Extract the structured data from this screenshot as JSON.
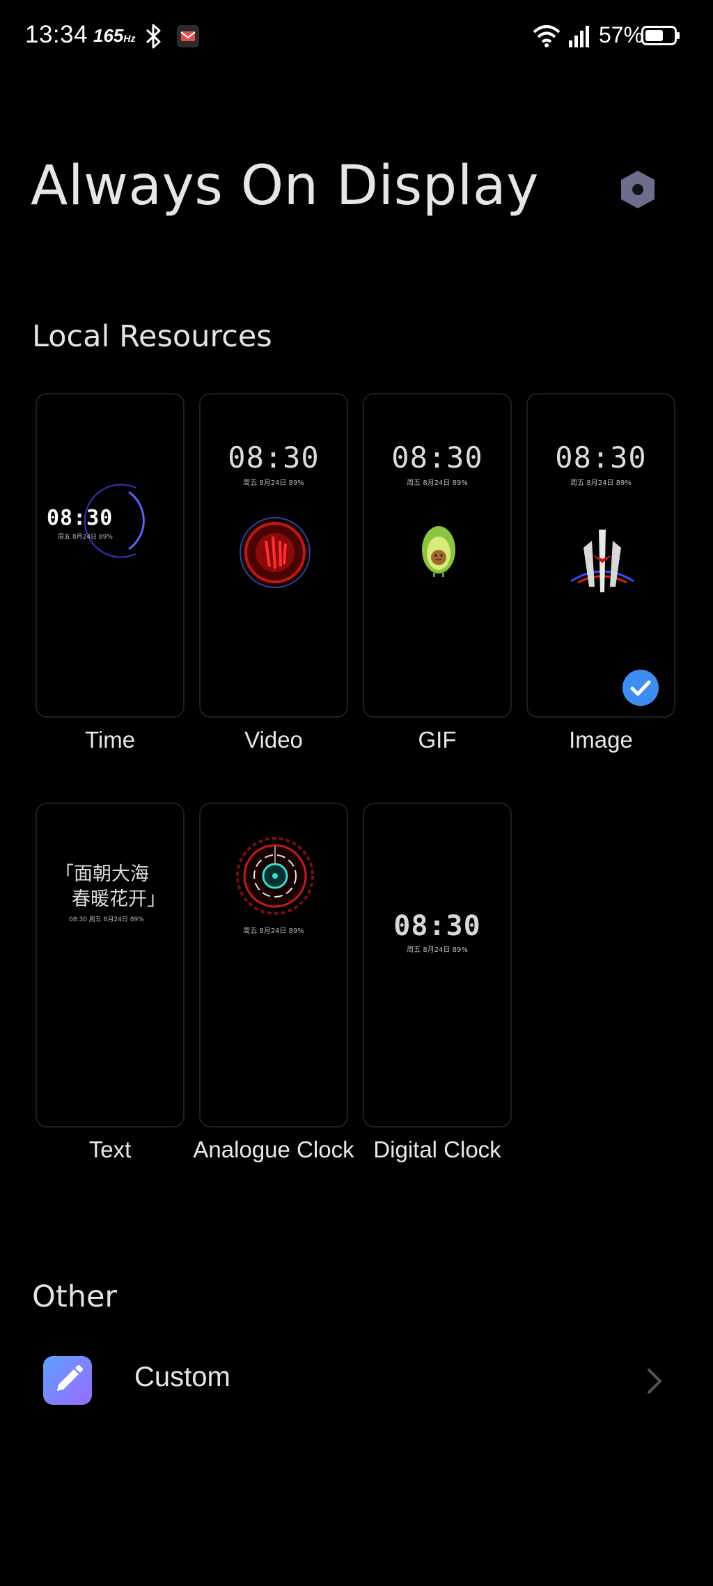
{
  "status_bar": {
    "time": "13:34",
    "refresh_rate": "165",
    "refresh_unit": "Hz",
    "battery_percent": "57%",
    "icons": [
      "bluetooth-icon",
      "mail-icon",
      "wifi-icon",
      "signal-icon",
      "battery-icon"
    ]
  },
  "header": {
    "title": "Always On Display",
    "settings_icon": "hexagon-settings-icon"
  },
  "local_resources": {
    "title": "Local Resources",
    "items": [
      {
        "label": "Time",
        "preview": {
          "clock": "08:30",
          "sub": "周五 8月24日 89%"
        },
        "selected": false
      },
      {
        "label": "Video",
        "preview": {
          "clock": "08:30",
          "sub": "周五 8月24日 89%"
        },
        "selected": false
      },
      {
        "label": "GIF",
        "preview": {
          "clock": "08:30",
          "sub": "周五 8月24日 89%"
        },
        "selected": false
      },
      {
        "label": "Image",
        "preview": {
          "clock": "08:30",
          "sub": "周五 8月24日 89%"
        },
        "selected": true
      },
      {
        "label": "Text",
        "preview": {
          "line1": "「面朝大海",
          "line2": "春暖花开」",
          "sub": "08:30 周五 8月24日 89%"
        },
        "selected": false
      },
      {
        "label": "Analogue Clock",
        "preview": {
          "sub": "周五 8月24日 89%"
        },
        "selected": false
      },
      {
        "label": "Digital Clock",
        "preview": {
          "clock": "08:30",
          "sub": "周五 8月24日 89%"
        },
        "selected": false
      }
    ]
  },
  "other": {
    "title": "Other",
    "items": [
      {
        "label": "Custom",
        "icon": "pencil-icon"
      }
    ]
  },
  "colors": {
    "background": "#000000",
    "accent": "#3d8ef0",
    "custom_icon_gradient": [
      "#5ea0ff",
      "#9a6bff"
    ]
  }
}
